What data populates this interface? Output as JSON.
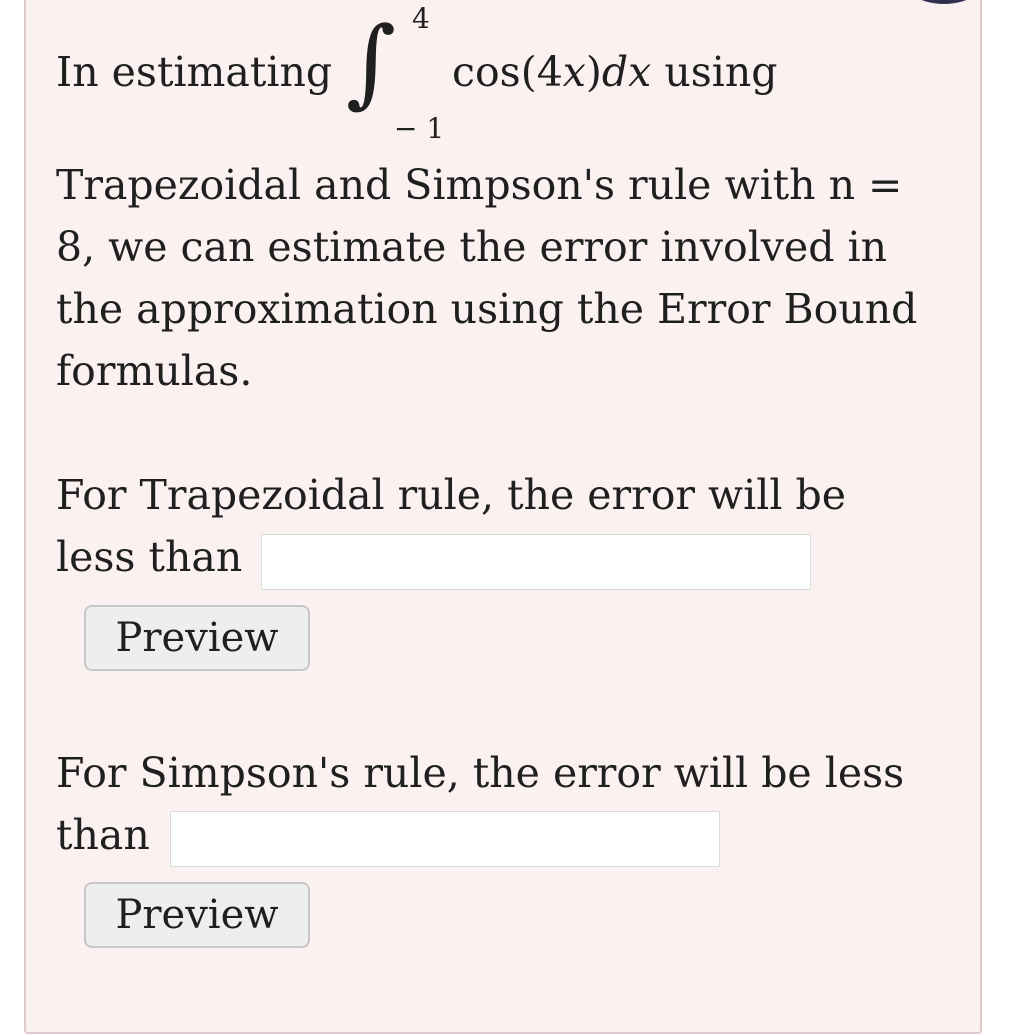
{
  "problem": {
    "intro": "In estimating",
    "integral": {
      "upper": "4",
      "lower": "− 1",
      "integrand_fn": "cos",
      "integrand_open": "(",
      "integrand_arg_coef": "4",
      "integrand_arg_var": "x",
      "integrand_close": ")",
      "differential": "dx"
    },
    "after_integral": "using",
    "lines": [
      "Trapezoidal and Simpson's rule with n =",
      "8, we can estimate the error involved in",
      "the approximation using the Error Bound",
      "formulas."
    ]
  },
  "trapezoidal": {
    "line1": "For Trapezoidal rule, the error will be",
    "line2": "less than",
    "input_value": "",
    "preview_label": "Preview"
  },
  "simpson": {
    "line1": "For Simpson's rule, the error will be less",
    "line2": "than",
    "input_value": "",
    "preview_label": "Preview"
  }
}
